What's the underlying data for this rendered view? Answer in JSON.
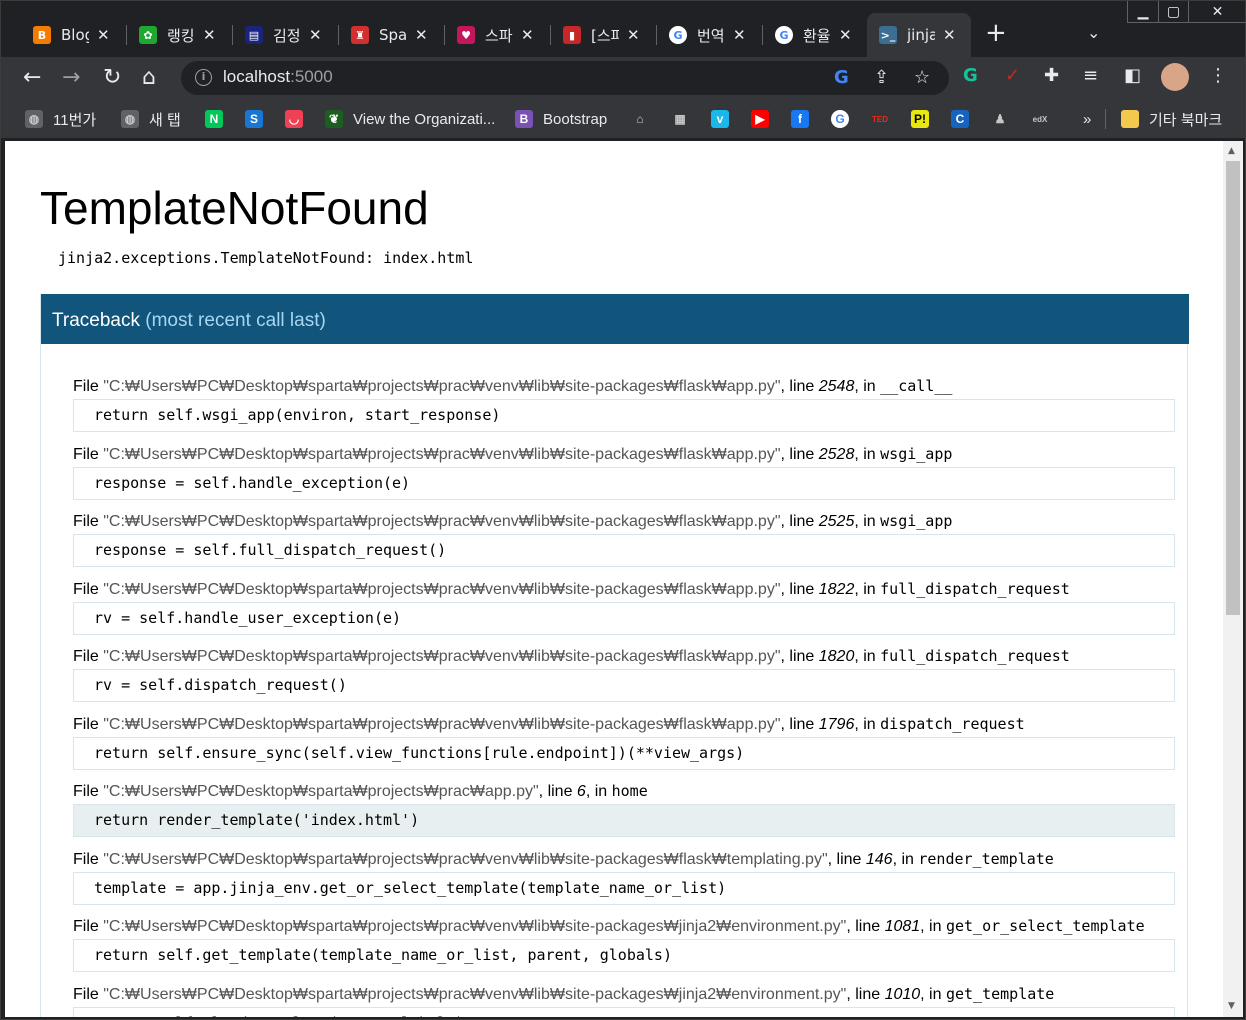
{
  "window_controls": {
    "minimize": "▁",
    "restore": "▢",
    "close": "✕"
  },
  "tabs": [
    {
      "title": "Blog",
      "icon": "blogger-icon",
      "color": "#f57c00",
      "glyph": "B"
    },
    {
      "title": "랭킹",
      "icon": "ranking-icon",
      "color": "#1fa831",
      "glyph": "✿"
    },
    {
      "title": "김정",
      "icon": "news-icon",
      "color": "#1a237e",
      "glyph": "▤"
    },
    {
      "title": "Spar",
      "icon": "sparta-icon",
      "color": "#d32f2f",
      "glyph": "♜"
    },
    {
      "title": "스파",
      "icon": "heart-icon",
      "color": "#c2185b",
      "glyph": "♥"
    },
    {
      "title": "[스파",
      "icon": "book-icon",
      "color": "#c62828",
      "glyph": "▮"
    },
    {
      "title": "번역",
      "icon": "google-icon",
      "color": "#ffffff",
      "glyph": "G"
    },
    {
      "title": "환율",
      "icon": "google-icon",
      "color": "#ffffff",
      "glyph": "G"
    },
    {
      "title": "jinja",
      "icon": "terminal-icon",
      "color": "#3c6e91",
      "glyph": ">_",
      "active": true
    }
  ],
  "toolbar": {
    "url_host": "localhost",
    "url_port": ":5000"
  },
  "bookmarks": [
    {
      "label": "11번가",
      "icon": "globe-icon",
      "color": "#5f6368",
      "glyph": "◍"
    },
    {
      "label": "새 탭",
      "icon": "globe-icon",
      "color": "#5f6368",
      "glyph": "◍"
    },
    {
      "label": "",
      "icon": "naver-icon",
      "color": "#03c75a",
      "glyph": "N"
    },
    {
      "label": "",
      "icon": "s-shape-icon",
      "color": "#1976d2",
      "glyph": "S"
    },
    {
      "label": "",
      "icon": "pocket-icon",
      "color": "#ef4056",
      "glyph": "◡"
    },
    {
      "label": "View the Organizati...",
      "icon": "leaf-icon",
      "color": "#1b5e20",
      "glyph": "❦"
    },
    {
      "label": "Bootstrap",
      "icon": "bootstrap-icon",
      "color": "#7952b3",
      "glyph": "B"
    },
    {
      "label": "",
      "icon": "airbnb-icon",
      "color": "#35363a",
      "glyph": "⌂"
    },
    {
      "label": "",
      "icon": "briefcase-icon",
      "color": "#35363a",
      "glyph": "▦"
    },
    {
      "label": "",
      "icon": "vimeo-icon",
      "color": "#1ab7ea",
      "glyph": "v"
    },
    {
      "label": "",
      "icon": "youtube-icon",
      "color": "#ff0000",
      "glyph": "▶"
    },
    {
      "label": "",
      "icon": "facebook-icon",
      "color": "#1877f2",
      "glyph": "f"
    },
    {
      "label": "",
      "icon": "google-icon",
      "color": "#ffffff",
      "glyph": "G"
    },
    {
      "label": "",
      "icon": "ted-icon",
      "color": "#35363a",
      "glyph": "TED"
    },
    {
      "label": "",
      "icon": "pi-icon",
      "color": "#e8e80c",
      "glyph": "P!"
    },
    {
      "label": "",
      "icon": "c-logo-icon",
      "color": "#1565c0",
      "glyph": "C"
    },
    {
      "label": "",
      "icon": "figure-icon",
      "color": "#35363a",
      "glyph": "♟"
    },
    {
      "label": "",
      "icon": "edx-icon",
      "color": "#35363a",
      "glyph": "edX"
    }
  ],
  "bookmarks_more": "»",
  "other_bookmarks": "기타 북마크",
  "page": {
    "title": "TemplateNotFound",
    "message": "jinja2.exceptions.TemplateNotFound: index.html",
    "traceback_title": "Traceback",
    "traceback_sub": "(most recent call last)",
    "frames": [
      {
        "path": "\"C:₩Users₩PC₩Desktop₩sparta₩projects₩prac₩venv₩lib₩site-packages₩flask₩app.py\"",
        "line": "2548",
        "func": "__call__",
        "code": "return self.wsgi_app(environ, start_response)",
        "current": false
      },
      {
        "path": "\"C:₩Users₩PC₩Desktop₩sparta₩projects₩prac₩venv₩lib₩site-packages₩flask₩app.py\"",
        "line": "2528",
        "func": "wsgi_app",
        "code": "response = self.handle_exception(e)",
        "current": false
      },
      {
        "path": "\"C:₩Users₩PC₩Desktop₩sparta₩projects₩prac₩venv₩lib₩site-packages₩flask₩app.py\"",
        "line": "2525",
        "func": "wsgi_app",
        "code": "response = self.full_dispatch_request()",
        "current": false
      },
      {
        "path": "\"C:₩Users₩PC₩Desktop₩sparta₩projects₩prac₩venv₩lib₩site-packages₩flask₩app.py\"",
        "line": "1822",
        "func": "full_dispatch_request",
        "code": "rv = self.handle_user_exception(e)",
        "current": false
      },
      {
        "path": "\"C:₩Users₩PC₩Desktop₩sparta₩projects₩prac₩venv₩lib₩site-packages₩flask₩app.py\"",
        "line": "1820",
        "func": "full_dispatch_request",
        "code": "rv = self.dispatch_request()",
        "current": false
      },
      {
        "path": "\"C:₩Users₩PC₩Desktop₩sparta₩projects₩prac₩venv₩lib₩site-packages₩flask₩app.py\"",
        "line": "1796",
        "func": "dispatch_request",
        "code": "return self.ensure_sync(self.view_functions[rule.endpoint])(**view_args)",
        "current": false
      },
      {
        "path": "\"C:₩Users₩PC₩Desktop₩sparta₩projects₩prac₩app.py\"",
        "line": "6",
        "func": "home",
        "code": "return render_template('index.html')",
        "current": true
      },
      {
        "path": "\"C:₩Users₩PC₩Desktop₩sparta₩projects₩prac₩venv₩lib₩site-packages₩flask₩templating.py\"",
        "line": "146",
        "func": "render_template",
        "code": "template = app.jinja_env.get_or_select_template(template_name_or_list)",
        "current": false
      },
      {
        "path": "\"C:₩Users₩PC₩Desktop₩sparta₩projects₩prac₩venv₩lib₩site-packages₩jinja2₩environment.py\"",
        "line": "1081",
        "func": "get_or_select_template",
        "code": "return self.get_template(template_name_or_list, parent, globals)",
        "current": false
      },
      {
        "path": "\"C:₩Users₩PC₩Desktop₩sparta₩projects₩prac₩venv₩lib₩site-packages₩jinja2₩environment.py\"",
        "line": "1010",
        "func": "get_template",
        "code": "return self._load_template(name, globals)",
        "current": false
      }
    ]
  },
  "colors": {
    "traceback_header": "#11557c",
    "traceback_sub": "#a6d6f1",
    "current_frame_bg": "#e8eff0"
  }
}
